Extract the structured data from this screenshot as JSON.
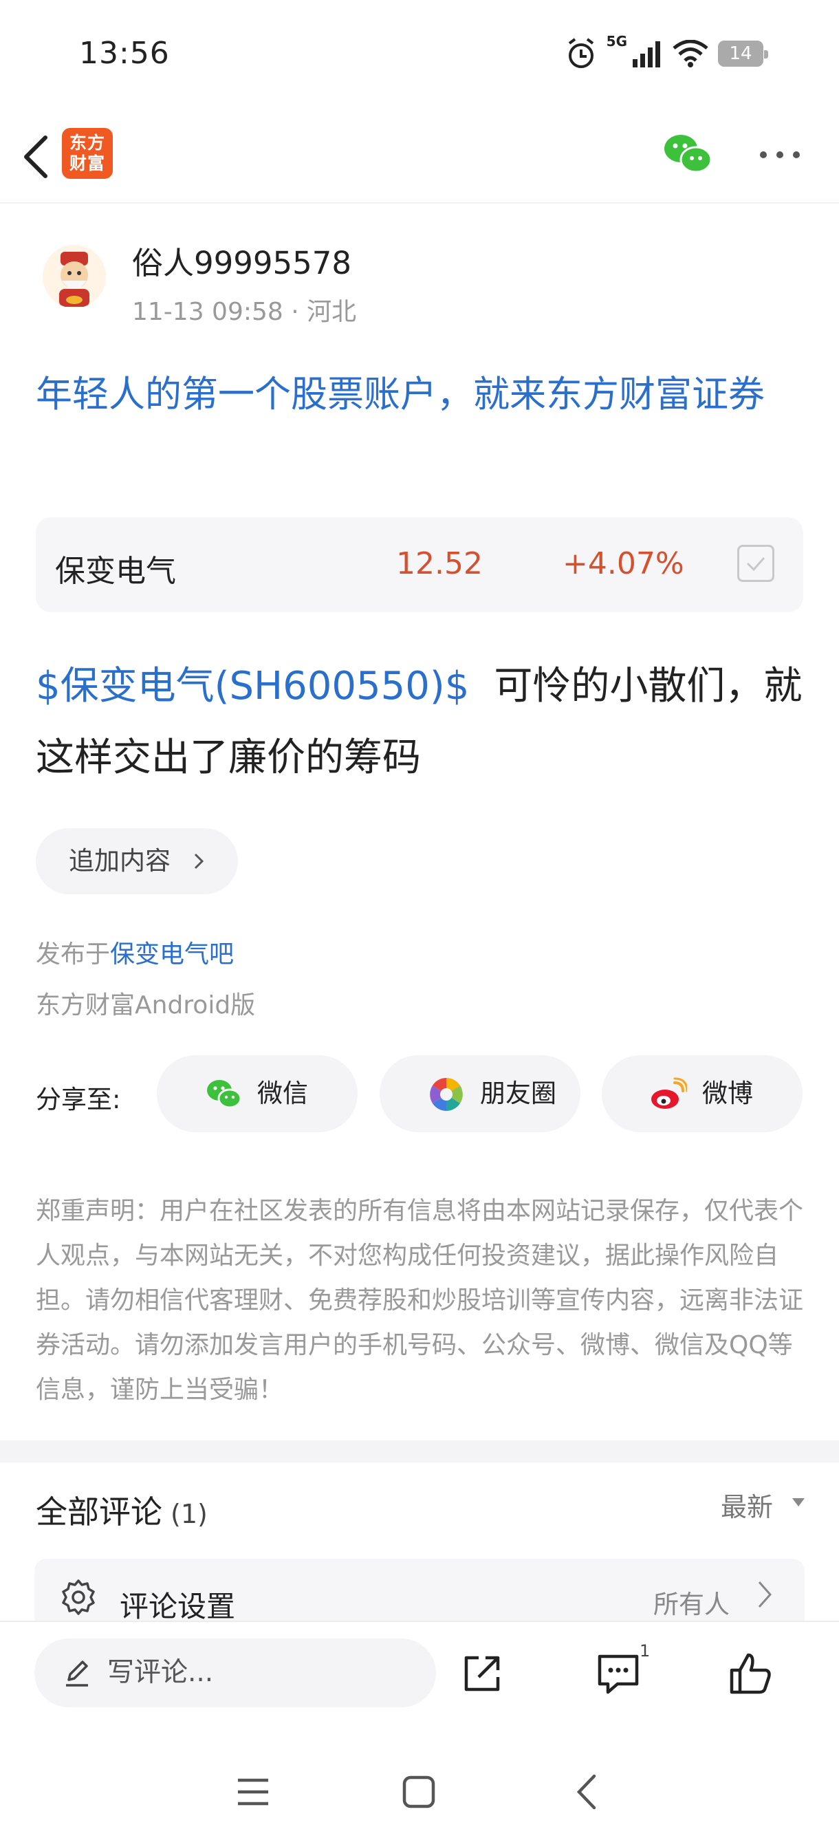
{
  "status_bar": {
    "time": "13:56",
    "network": "5G",
    "battery": "14"
  },
  "nav": {
    "logo_text": "东方财富",
    "brand_color": "#f05a22"
  },
  "author": {
    "name": "俗人99995578",
    "meta": "11-13 09:58 · 河北"
  },
  "post": {
    "title": "年轻人的第一个股票账户，就来东方财富证券",
    "stock": {
      "name": "保变电气",
      "price": "12.52",
      "change": "+4.07%"
    },
    "tag": "$保变电气(SH600550)$",
    "body": "可怜的小散们，就这样交出了廉价的筹码",
    "add_content_label": "追加内容",
    "published_prefix": "发布于",
    "published_bar": "保变电气吧",
    "platform": "东方财富Android版"
  },
  "share": {
    "label": "分享至:",
    "wechat": "微信",
    "moments": "朋友圈",
    "weibo": "微博"
  },
  "disclaimer": "郑重声明：用户在社区发表的所有信息将由本网站记录保存，仅代表个人观点，与本网站无关，不对您构成任何投资建议，据此操作风险自担。请勿相信代客理财、免费荐股和炒股培训等宣传内容，远离非法证券活动。请勿添加发言用户的手机号码、公众号、微博、微信及QQ等信息，谨防上当受骗！",
  "comments": {
    "title": "全部评论",
    "count": "(1)",
    "sort": "最新",
    "settings_label": "评论设置",
    "settings_value": "所有人"
  },
  "bottom_bar": {
    "write_placeholder": "写评论...",
    "comment_badge": "1"
  },
  "colors": {
    "link_blue": "#2b6fcc",
    "stock_red": "#d4502e",
    "muted": "#999999"
  }
}
